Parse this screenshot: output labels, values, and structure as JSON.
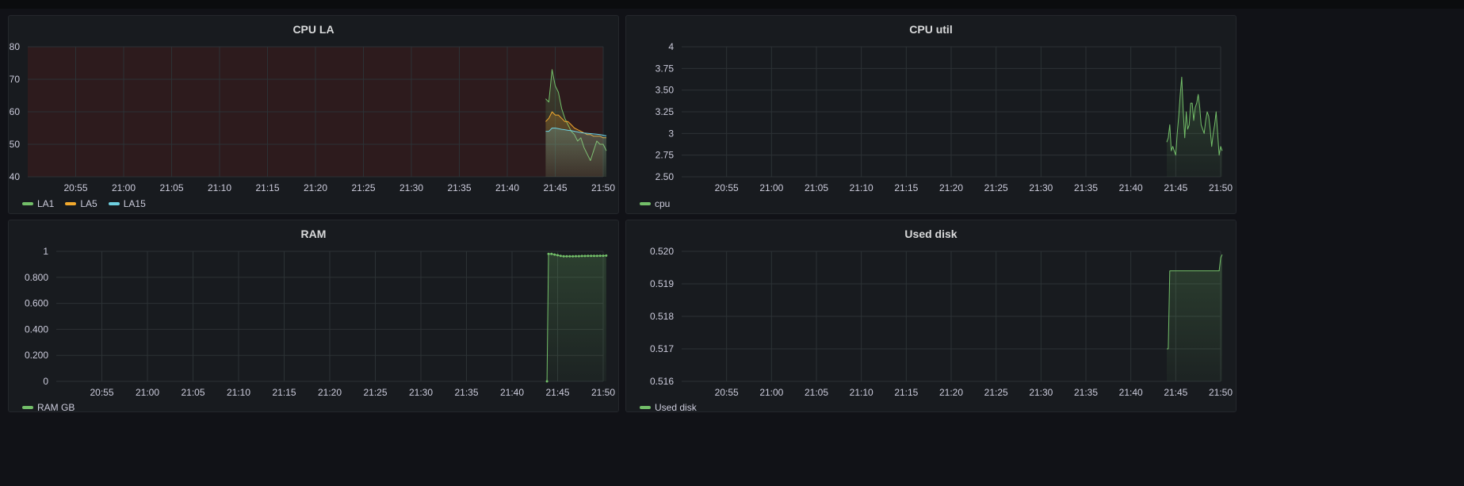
{
  "panels": [
    {
      "id": "cpu-la",
      "title": "CPU LA",
      "chart_data": {
        "type": "line",
        "title": "CPU LA",
        "xlabel": "",
        "ylabel": "",
        "ylim": [
          40,
          80
        ],
        "yticks": [
          40,
          50,
          60,
          70,
          80
        ],
        "ytick_labels": [
          "40",
          "50",
          "60",
          "70",
          "80"
        ],
        "xlim": [
          "20:50",
          "21:50"
        ],
        "xticks": [
          "20:55",
          "21:00",
          "21:05",
          "21:10",
          "21:15",
          "21:20",
          "21:25",
          "21:30",
          "21:35",
          "21:40",
          "21:45",
          "21:50"
        ],
        "threshold_region": {
          "from": 40,
          "to": 80,
          "color": "#2d1b1d"
        },
        "grid": true,
        "legend": "bottom-left",
        "x": [
          "21:44:00",
          "21:44:20",
          "21:44:40",
          "21:45:00",
          "21:45:20",
          "21:45:40",
          "21:46:00",
          "21:46:20",
          "21:46:40",
          "21:47:00",
          "21:47:20",
          "21:47:40",
          "21:48:00",
          "21:48:20",
          "21:48:40",
          "21:49:00",
          "21:49:20",
          "21:49:40",
          "21:50:00",
          "21:50:20"
        ],
        "series": [
          {
            "name": "LA1",
            "color": "#73bf69",
            "values": [
              64,
              63,
              73,
              68,
              66,
              61,
              58,
              56,
              54,
              53,
              51,
              52,
              49,
              47,
              45,
              48,
              51,
              50,
              50,
              48
            ]
          },
          {
            "name": "LA5",
            "color": "#f2a92d",
            "values": [
              57,
              58,
              60,
              59,
              59,
              58,
              57,
              57,
              56,
              55,
              54.5,
              54,
              53.5,
              53,
              53,
              52.5,
              52.5,
              52.5,
              52,
              52
            ]
          },
          {
            "name": "LA15",
            "color": "#6ed0e0",
            "values": [
              54,
              54,
              55,
              55,
              54.8,
              54.6,
              54.5,
              54.3,
              54.2,
              54,
              53.8,
              53.6,
              53.5,
              53.4,
              53.3,
              53.2,
              53.1,
              53,
              52.8,
              52.6
            ]
          }
        ]
      }
    },
    {
      "id": "cpu-util",
      "title": "CPU util",
      "chart_data": {
        "type": "line",
        "title": "CPU util",
        "xlabel": "",
        "ylabel": "",
        "ylim": [
          2.5,
          4
        ],
        "yticks": [
          2.5,
          2.75,
          3,
          3.25,
          3.5,
          3.75,
          4
        ],
        "ytick_labels": [
          "2.50",
          "2.75",
          "3",
          "3.25",
          "3.50",
          "3.75",
          "4"
        ],
        "xlim": [
          "20:50",
          "21:50"
        ],
        "xticks": [
          "20:55",
          "21:00",
          "21:05",
          "21:10",
          "21:15",
          "21:20",
          "21:25",
          "21:30",
          "21:35",
          "21:40",
          "21:45",
          "21:50"
        ],
        "grid": true,
        "legend": "bottom-left",
        "x": [
          "21:44:00",
          "21:44:10",
          "21:44:20",
          "21:44:30",
          "21:44:40",
          "21:44:50",
          "21:45:00",
          "21:45:10",
          "21:45:20",
          "21:45:30",
          "21:45:40",
          "21:45:50",
          "21:46:00",
          "21:46:10",
          "21:46:20",
          "21:46:30",
          "21:46:40",
          "21:46:50",
          "21:47:00",
          "21:47:10",
          "21:47:20",
          "21:47:30",
          "21:47:40",
          "21:47:50",
          "21:48:00",
          "21:48:10",
          "21:48:20",
          "21:48:30",
          "21:48:40",
          "21:48:50",
          "21:49:00",
          "21:49:10",
          "21:49:20",
          "21:49:30",
          "21:49:40",
          "21:49:50",
          "21:50:00",
          "21:50:10"
        ],
        "series": [
          {
            "name": "cpu",
            "color": "#73bf69",
            "values": [
              2.9,
              2.95,
              3.1,
              2.8,
              2.85,
              2.8,
              2.75,
              3.0,
              3.2,
              3.45,
              3.65,
              3.25,
              2.95,
              3.25,
              3.05,
              3.1,
              3.35,
              3.35,
              3.15,
              3.3,
              3.35,
              3.45,
              3.3,
              3.1,
              3.05,
              3.0,
              3.15,
              3.25,
              3.2,
              3.05,
              2.85,
              3.0,
              3.1,
              3.25,
              3.0,
              2.75,
              2.85,
              2.8
            ]
          }
        ]
      }
    },
    {
      "id": "ram",
      "title": "RAM",
      "chart_data": {
        "type": "line",
        "title": "RAM",
        "xlabel": "",
        "ylabel": "",
        "ylim": [
          0,
          1
        ],
        "yticks": [
          0,
          0.2,
          0.4,
          0.6,
          0.8,
          1
        ],
        "ytick_labels": [
          "0",
          "0.200",
          "0.400",
          "0.600",
          "0.800",
          "1"
        ],
        "xlim": [
          "20:50",
          "21:50"
        ],
        "xticks": [
          "20:55",
          "21:00",
          "21:05",
          "21:10",
          "21:15",
          "21:20",
          "21:25",
          "21:30",
          "21:35",
          "21:40",
          "21:45",
          "21:50"
        ],
        "grid": true,
        "legend": "bottom-left",
        "x": [
          "21:43:50",
          "21:44:00",
          "21:44:20",
          "21:44:40",
          "21:45:00",
          "21:45:20",
          "21:45:40",
          "21:46:00",
          "21:46:20",
          "21:46:40",
          "21:47:00",
          "21:47:20",
          "21:47:40",
          "21:48:00",
          "21:48:20",
          "21:48:40",
          "21:49:00",
          "21:49:20",
          "21:49:40",
          "21:50:00",
          "21:50:20"
        ],
        "series": [
          {
            "name": "RAM GB",
            "color": "#73bf69",
            "values": [
              0,
              0.98,
              0.98,
              0.975,
              0.97,
              0.965,
              0.962,
              0.962,
              0.962,
              0.962,
              0.963,
              0.963,
              0.964,
              0.964,
              0.965,
              0.965,
              0.965,
              0.965,
              0.966,
              0.966,
              0.967
            ]
          }
        ]
      }
    },
    {
      "id": "used-disk",
      "title": "Used disk",
      "chart_data": {
        "type": "line",
        "title": "Used disk",
        "xlabel": "",
        "ylabel": "",
        "ylim": [
          0.516,
          0.52
        ],
        "yticks": [
          0.516,
          0.517,
          0.518,
          0.519,
          0.52
        ],
        "ytick_labels": [
          "0.516",
          "0.517",
          "0.518",
          "0.519",
          "0.520"
        ],
        "xlim": [
          "20:50",
          "21:50"
        ],
        "xticks": [
          "20:55",
          "21:00",
          "21:05",
          "21:10",
          "21:15",
          "21:20",
          "21:25",
          "21:30",
          "21:35",
          "21:40",
          "21:45",
          "21:50"
        ],
        "grid": true,
        "legend": "bottom-left",
        "x": [
          "21:44:00",
          "21:44:10",
          "21:44:20",
          "21:44:40",
          "21:45:00",
          "21:46:00",
          "21:47:00",
          "21:48:00",
          "21:49:00",
          "21:49:40",
          "21:49:50",
          "21:50:00",
          "21:50:10"
        ],
        "series": [
          {
            "name": "Used disk",
            "color": "#73bf69",
            "values": [
              0.517,
              0.517,
              0.5194,
              0.5194,
              0.5194,
              0.5194,
              0.5194,
              0.5194,
              0.5194,
              0.5194,
              0.5194,
              0.5198,
              0.5199
            ]
          }
        ]
      }
    }
  ]
}
